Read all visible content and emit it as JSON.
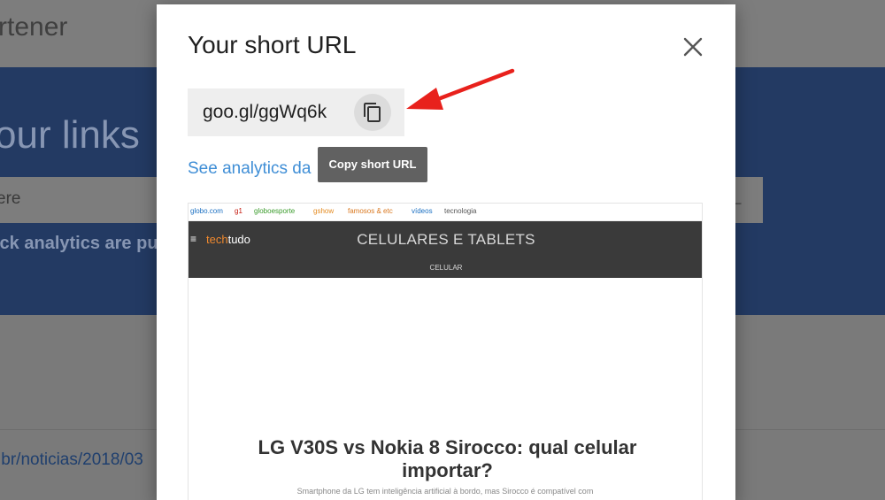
{
  "background": {
    "title": "rtener",
    "heading": "our links",
    "input_placeholder": "ere",
    "button_label": "L",
    "subtext": "ick analytics are pu",
    "link_row": ".br/noticias/2018/03"
  },
  "dialog": {
    "title": "Your short URL",
    "short_url": "goo.gl/ggWq6k",
    "analytics_link": "See analytics da",
    "tooltip": "Copy short URL",
    "preview": {
      "topbar_links": [
        {
          "label": "globo.com",
          "color": "#1a6fc2"
        },
        {
          "label": "g1",
          "color": "#c4170c"
        },
        {
          "label": "globoesporte",
          "color": "#3a9b2b"
        },
        {
          "label": "gshow",
          "color": "#e48a1f"
        },
        {
          "label": "famosos & etc",
          "color": "#d9771e"
        },
        {
          "label": "vídeos",
          "color": "#1a6fc2"
        },
        {
          "label": "tecnologia",
          "color": "#555555"
        }
      ],
      "logo_tech": "tech",
      "logo_tudo": "tudo",
      "section": "CELULARES E TABLETS",
      "subsection": "CELULAR",
      "headline": "LG V30S vs Nokia 8 Sirocco: qual celular importar?",
      "summary": "Smartphone da LG tem inteligência artificial à bordo, mas Sirocco é compatível com"
    }
  }
}
